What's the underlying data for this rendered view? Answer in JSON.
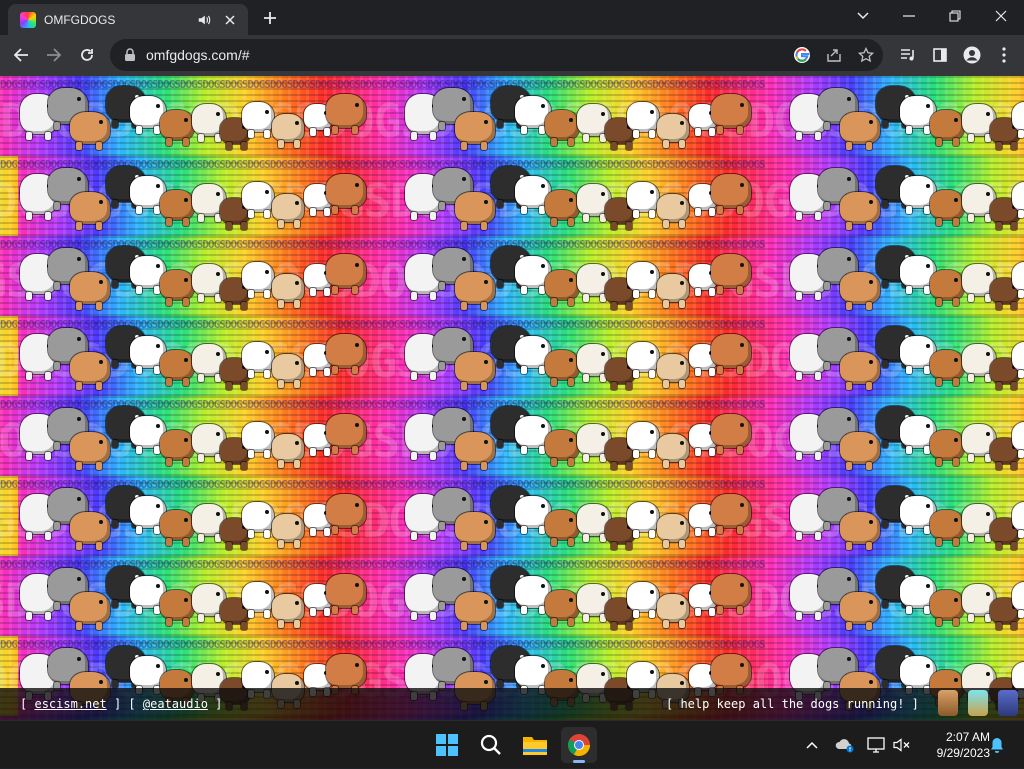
{
  "browser": {
    "tab_title": "OMFGDOGS",
    "url": "omfgdogs.com/#"
  },
  "page": {
    "banner_word": "DOGS",
    "banner_big": "DOGSDOGSDOGSDOGSDOGSDOGSDOGSDOGSDOGSDOGSDOGSDOGSDOGSDOGSDOGSDOGSDOGSDOGSDOGSDOGS",
    "banner_small": "DOGSDOGSDOGSDOGSDOGSDOGSDOGSDOGSDOGSDOGSDOGSDOGSDOGSDOGSDOGSDOGSDOGSDOGSDOGSDOGSDOGSDOGSDOGSDOGSDOGSDOGSDOGSDOGSDOGSDOGSDOGSDOGSDOGSDOGS",
    "footer": {
      "bracket_open": "[",
      "bracket_close": "]",
      "link1": "escism.net",
      "link2": "@eataudio",
      "right_text": "[ help keep all the dogs running! ]"
    }
  },
  "taskbar": {
    "time": "2:07 AM",
    "date": "9/29/2023"
  },
  "icons": {
    "tab": [
      "favicon-rainbow",
      "speaker-icon",
      "close-icon",
      "plus-icon"
    ],
    "window": [
      "chevron-down-icon",
      "minimize-icon",
      "restore-icon",
      "close-icon"
    ],
    "toolbar": [
      "back-arrow-icon",
      "forward-arrow-icon",
      "reload-icon",
      "lock-icon",
      "google-icon",
      "share-icon",
      "star-icon",
      "media-icon",
      "side-panel-icon",
      "profile-icon",
      "more-vert-icon"
    ],
    "taskbar": [
      "windows-start-icon",
      "search-icon",
      "file-explorer-icon",
      "chrome-icon",
      "chevron-up-icon",
      "onedrive-icon",
      "display-icon",
      "speaker-muted-icon",
      "bell-icon"
    ]
  },
  "colors": {
    "chrome_dark": "#202124",
    "chrome_toolbar": "#35363a",
    "taskbar": "#1c1c1c"
  }
}
